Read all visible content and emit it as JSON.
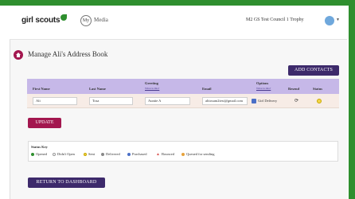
{
  "header": {
    "logo_text": "girl scouts",
    "my_label": "My",
    "media_label": "Media",
    "council_label": "M2 GS Test Council 1 Trophy"
  },
  "page": {
    "title": "Manage Ali's Address Book",
    "add_contacts_label": "ADD CONTACTS",
    "update_label": "UPDATE",
    "return_label": "RETURN TO DASHBOARD"
  },
  "table": {
    "headers": {
      "first_name": "First Name",
      "last_name": "Last Name",
      "greeting": "Greeting",
      "greeting_help": "What is this?",
      "email": "Email",
      "options": "Options",
      "options_help": "What is this?",
      "resend": "Resend",
      "status": "Status"
    },
    "row": {
      "first_name": "Ali",
      "last_name": "Tosa",
      "greeting": "Auntie A",
      "email": "alitosam2test@gmail.com",
      "option_label": "Girl Delivery",
      "resend_icon": "resend-icon",
      "status": "Sent"
    }
  },
  "status_key": {
    "title": "Status Key",
    "items": [
      {
        "label": "Opened",
        "color": "#2f8f2f"
      },
      {
        "label": "Didn't Open",
        "color": "#ffffff"
      },
      {
        "label": "Sent",
        "color": "#f3d64a"
      },
      {
        "label": "Delivered",
        "color": "#888888"
      },
      {
        "label": "Purchased",
        "color": "#4b6fc7"
      },
      {
        "label": "Bounced",
        "color": "#d9534f"
      },
      {
        "label": "Queued for sending",
        "color": "#e6a23c"
      }
    ]
  },
  "colors": {
    "accent_purple": "#3d2a6b",
    "accent_magenta": "#a3174f",
    "brand_green": "#2f8f2f",
    "table_header": "#c6b8e8"
  }
}
